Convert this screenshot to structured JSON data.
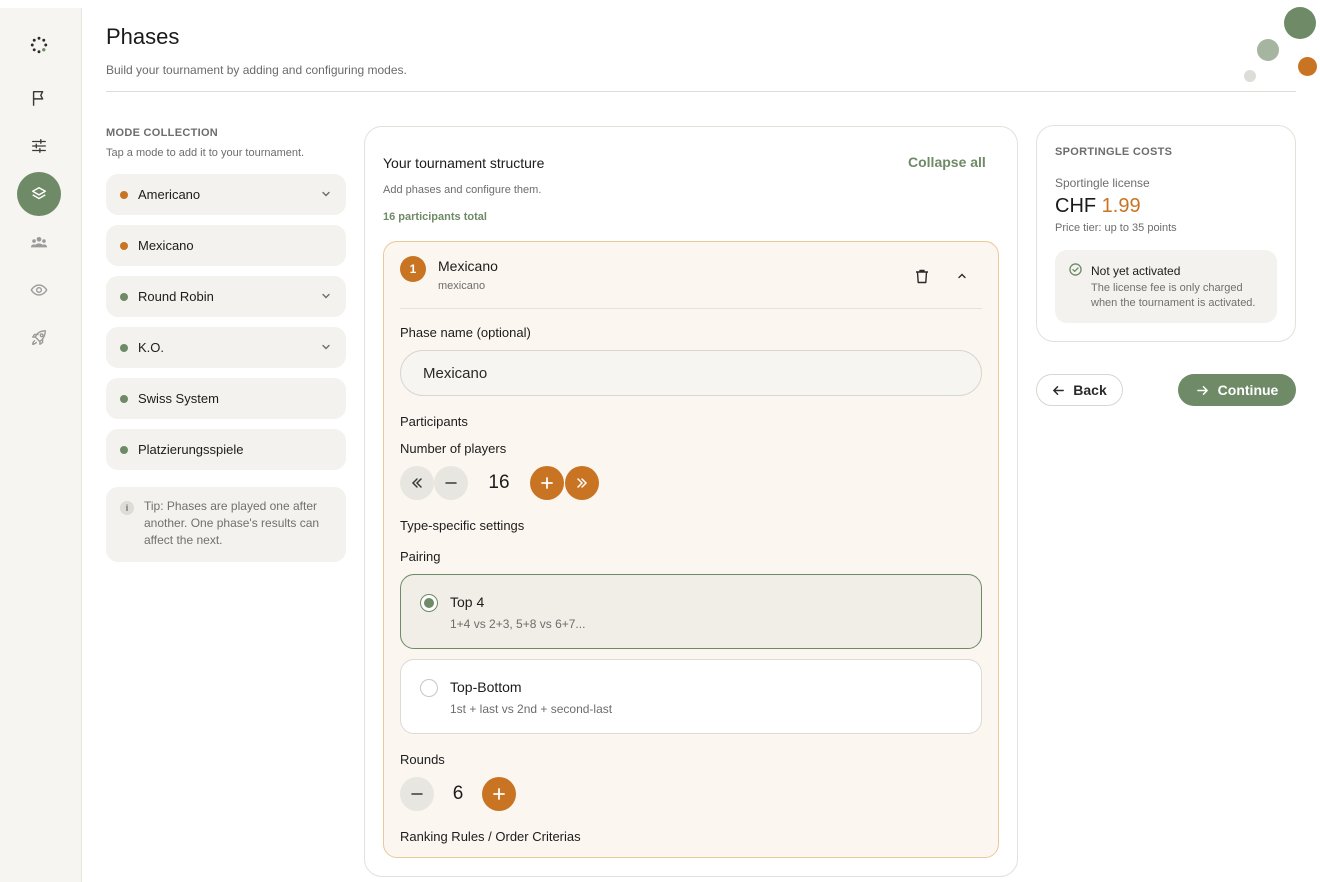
{
  "sidebar": {
    "items": [
      {
        "icon": "logo-ring-icon"
      },
      {
        "icon": "flag-icon"
      },
      {
        "icon": "sliders-icon"
      },
      {
        "icon": "layers-icon",
        "active": true
      },
      {
        "icon": "people-icon"
      },
      {
        "icon": "eye-icon"
      },
      {
        "icon": "rocket-icon"
      }
    ]
  },
  "header": {
    "title": "Phases",
    "subtitle": "Build your tournament by adding and configuring modes."
  },
  "colors": {
    "accent_green": "#6e8a66",
    "accent_orange": "#c87423",
    "light_green": "#a6b59f",
    "pale_grey": "#dcdcd8"
  },
  "mode_collection": {
    "heading": "MODE COLLECTION",
    "subtitle": "Tap a mode to add it to your tournament.",
    "modes": [
      {
        "label": "Americano",
        "color": "#c87423",
        "expandable": true
      },
      {
        "label": "Mexicano",
        "color": "#c87423",
        "expandable": false
      },
      {
        "label": "Round Robin",
        "color": "#6e8a66",
        "expandable": true
      },
      {
        "label": "K.O.",
        "color": "#6e8a66",
        "expandable": true
      },
      {
        "label": "Swiss System",
        "color": "#6e8a66",
        "expandable": false
      },
      {
        "label": "Platzierungsspiele",
        "color": "#6e8a66",
        "expandable": false
      }
    ],
    "tip_icon": "i",
    "tip": "Tip: Phases are played one after another. One phase's results can affect the next."
  },
  "structure": {
    "title": "Your tournament structure",
    "collapse_label": "Collapse all",
    "subtitle": "Add phases and configure them.",
    "participants_total": "16 participants total",
    "phase": {
      "number": "1",
      "name": "Mexicano",
      "type": "mexicano",
      "name_label": "Phase name (optional)",
      "name_value": "Mexicano",
      "participants_heading": "Participants",
      "players_label": "Number of players",
      "players_value": "16",
      "type_settings_heading": "Type-specific settings",
      "pairing_label": "Pairing",
      "pairing_options": [
        {
          "title": "Top 4",
          "description": "1+4 vs 2+3, 5+8 vs 6+7...",
          "selected": true
        },
        {
          "title": "Top-Bottom",
          "description": "1st + last vs 2nd + second-last",
          "selected": false
        }
      ],
      "rounds_label": "Rounds",
      "rounds_value": "6",
      "ranking_label": "Ranking Rules / Order Criterias"
    }
  },
  "costs": {
    "heading": "SPORTINGLE COSTS",
    "license_label": "Sportingle license",
    "currency": "CHF",
    "amount": "1.99",
    "tier": "Price tier: up to 35 points",
    "status_title": "Not yet activated",
    "status_desc": "The license fee is only charged when the tournament is activated."
  },
  "actions": {
    "back_label": "Back",
    "continue_label": "Continue"
  }
}
